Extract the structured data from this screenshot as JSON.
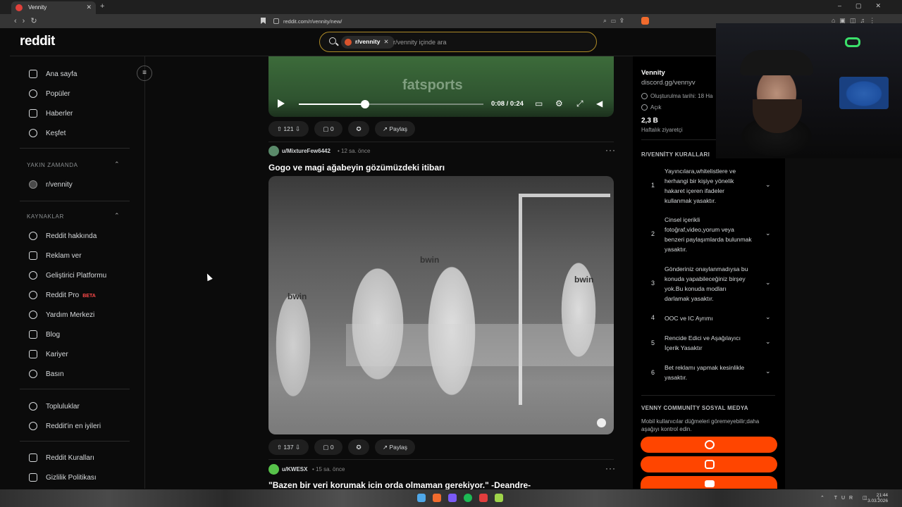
{
  "browser": {
    "tab_title": "Vennity",
    "url": "reddit.com/r/vennity/new/"
  },
  "header": {
    "logo": "reddit",
    "search_chip": "r/vennity",
    "search_placeholder": "r/vennity içinde ara"
  },
  "sidebar": {
    "main": [
      "Ana sayfa",
      "Popüler",
      "Haberler",
      "Keşfet"
    ],
    "recent_header": "YAKIN ZAMANDA",
    "recent": [
      "r/vennity"
    ],
    "resources_header": "KAYNAKLAR",
    "resources": [
      "Reddit hakkında",
      "Reklam ver",
      "Geliştirici Platformu",
      "Reddit Pro",
      "Yardım Merkezi",
      "Blog",
      "Kariyer",
      "Basın"
    ],
    "beta": "BETA",
    "communities": [
      "Topluluklar",
      "Reddit'in en iyileri"
    ],
    "legal": [
      "Reddit Kuralları",
      "Gizlilik Politikası"
    ]
  },
  "video": {
    "watermark": "fatsports",
    "time": "0:08 / 0:24",
    "progress": 0.36
  },
  "posts": [
    {
      "votes": "121",
      "comments": "0",
      "share": "Paylaş"
    },
    {
      "user": "u/MixtureFew6442",
      "age": "• 12 sa. önce",
      "title": "Gogo ve magi ağabeyin gözümüzdeki itibarı",
      "votes": "137",
      "comments": "0",
      "share": "Paylaş",
      "image_text": [
        "bwin",
        "bwin",
        "bwin"
      ]
    },
    {
      "user": "u/KWESX",
      "age": "• 15 sa. önce",
      "title": "\"Bazen bir veri korumak icin orda olmaman gerekiyor.\" -Deandre-"
    }
  ],
  "community": {
    "name": "Vennity",
    "link": "discord.gg/vennyv",
    "created": "Oluşturulma tarihi: 18 Ha",
    "status": "Açık",
    "visitors": "2,3 B",
    "visitors_label": "Haftalık ziyaretçi",
    "rules_header": "R/VENNİTY KURALLARI",
    "rules": [
      {
        "n": "1",
        "text": "Yayıncılara,whitelistlere ve herhangi bir kişiye yönelik hakaret içeren ifadeler kullanmak yasaktır."
      },
      {
        "n": "2",
        "text": "Cinsel içerikli fotoğraf,video,yorum veya benzeri paylaşımlarda bulunmak yasaktır."
      },
      {
        "n": "3",
        "text": "Gönderiniz onaylanmadıysa bu konuda yapabileceğiniz birşey yok.Bu konuda modları darlamak yasaktır."
      },
      {
        "n": "4",
        "text": "OOC ve IC Ayrımı"
      },
      {
        "n": "5",
        "text": "Rencide Edici ve Aşağılayıcı İçerik Yasaktır"
      },
      {
        "n": "6",
        "text": "Bet reklamı yapmak kesinlikle yasaktır."
      }
    ],
    "social_header": "VENNY COMMUNİTY SOSYAL MEDYA",
    "social_note": "Mobil kullanıcılar düğmeleri göremeyebilir;daha aşağıyı kontrol edin."
  },
  "taskbar": {
    "lang": "TUR",
    "time": "21:44",
    "date": "3.03.2026"
  },
  "colors": {
    "accent": "#ff4500",
    "search_border": "#ad8a27",
    "beta": "#ff4a4a"
  }
}
